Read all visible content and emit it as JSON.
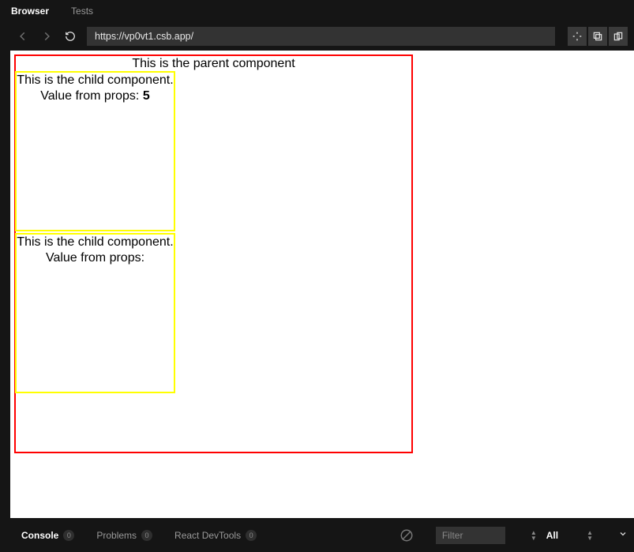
{
  "tabs": {
    "browser": "Browser",
    "tests": "Tests"
  },
  "addressBar": {
    "url": "https://vp0vt1.csb.app/"
  },
  "preview": {
    "parent": {
      "title": "This is the parent component"
    },
    "children": [
      {
        "line1": "This is the child component.",
        "line2_prefix": "Value from props: ",
        "value": "5"
      },
      {
        "line1": "This is the child component.",
        "line2_prefix": "Value from props:",
        "value": ""
      }
    ]
  },
  "bottom": {
    "console": {
      "label": "Console",
      "count": "0"
    },
    "problems": {
      "label": "Problems",
      "count": "0"
    },
    "devtools": {
      "label": "React DevTools",
      "count": "0"
    },
    "filter_placeholder": "Filter",
    "level": "All"
  }
}
